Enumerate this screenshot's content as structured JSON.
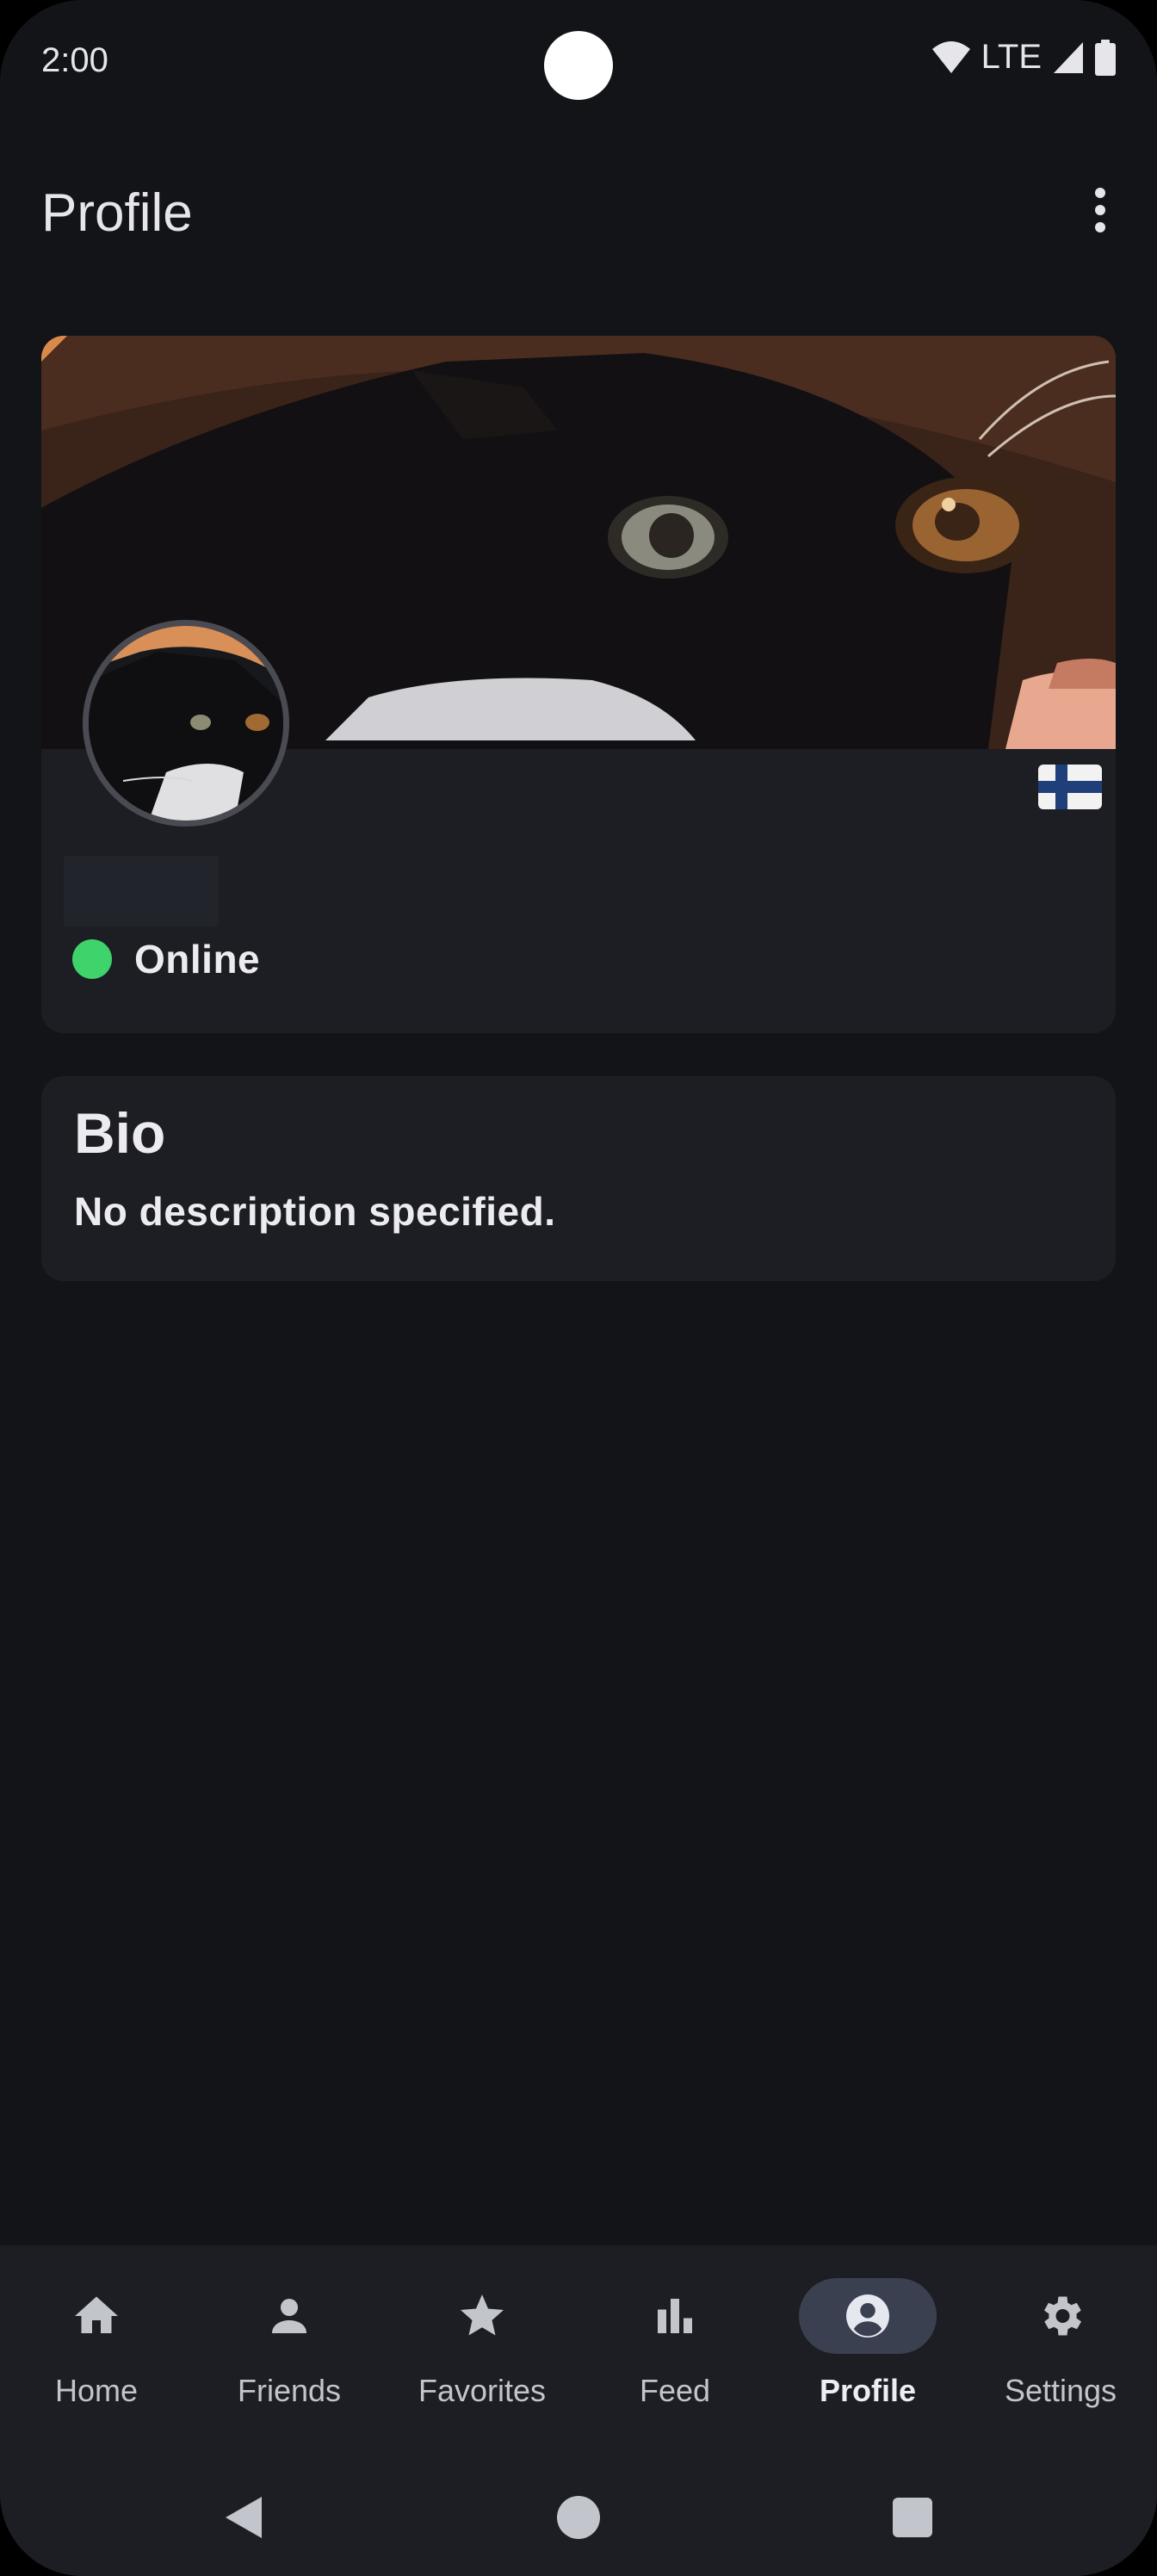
{
  "status_bar": {
    "time": "2:00",
    "network": "LTE",
    "icons": [
      "wifi-icon",
      "signal-icon",
      "battery-icon"
    ]
  },
  "app_bar": {
    "title": "Profile",
    "menu_icon": "more-vert-icon"
  },
  "profile": {
    "status": "Online",
    "status_color": "#3fd36c",
    "country_flag": "Finland"
  },
  "bio": {
    "title": "Bio",
    "text": "No description specified."
  },
  "nav": {
    "items": [
      {
        "label": "Home",
        "icon": "home-icon"
      },
      {
        "label": "Friends",
        "icon": "person-icon"
      },
      {
        "label": "Favorites",
        "icon": "star-icon"
      },
      {
        "label": "Feed",
        "icon": "bar-chart-icon"
      },
      {
        "label": "Profile",
        "icon": "account-circle-icon",
        "active": true
      },
      {
        "label": "Settings",
        "icon": "gear-icon"
      }
    ]
  },
  "system_nav": [
    "back-icon",
    "home-circle-icon",
    "recents-icon"
  ],
  "colors": {
    "background": "#131418",
    "card": "#1d1e23",
    "active_pill": "#3b4050",
    "online": "#3fd36c"
  }
}
